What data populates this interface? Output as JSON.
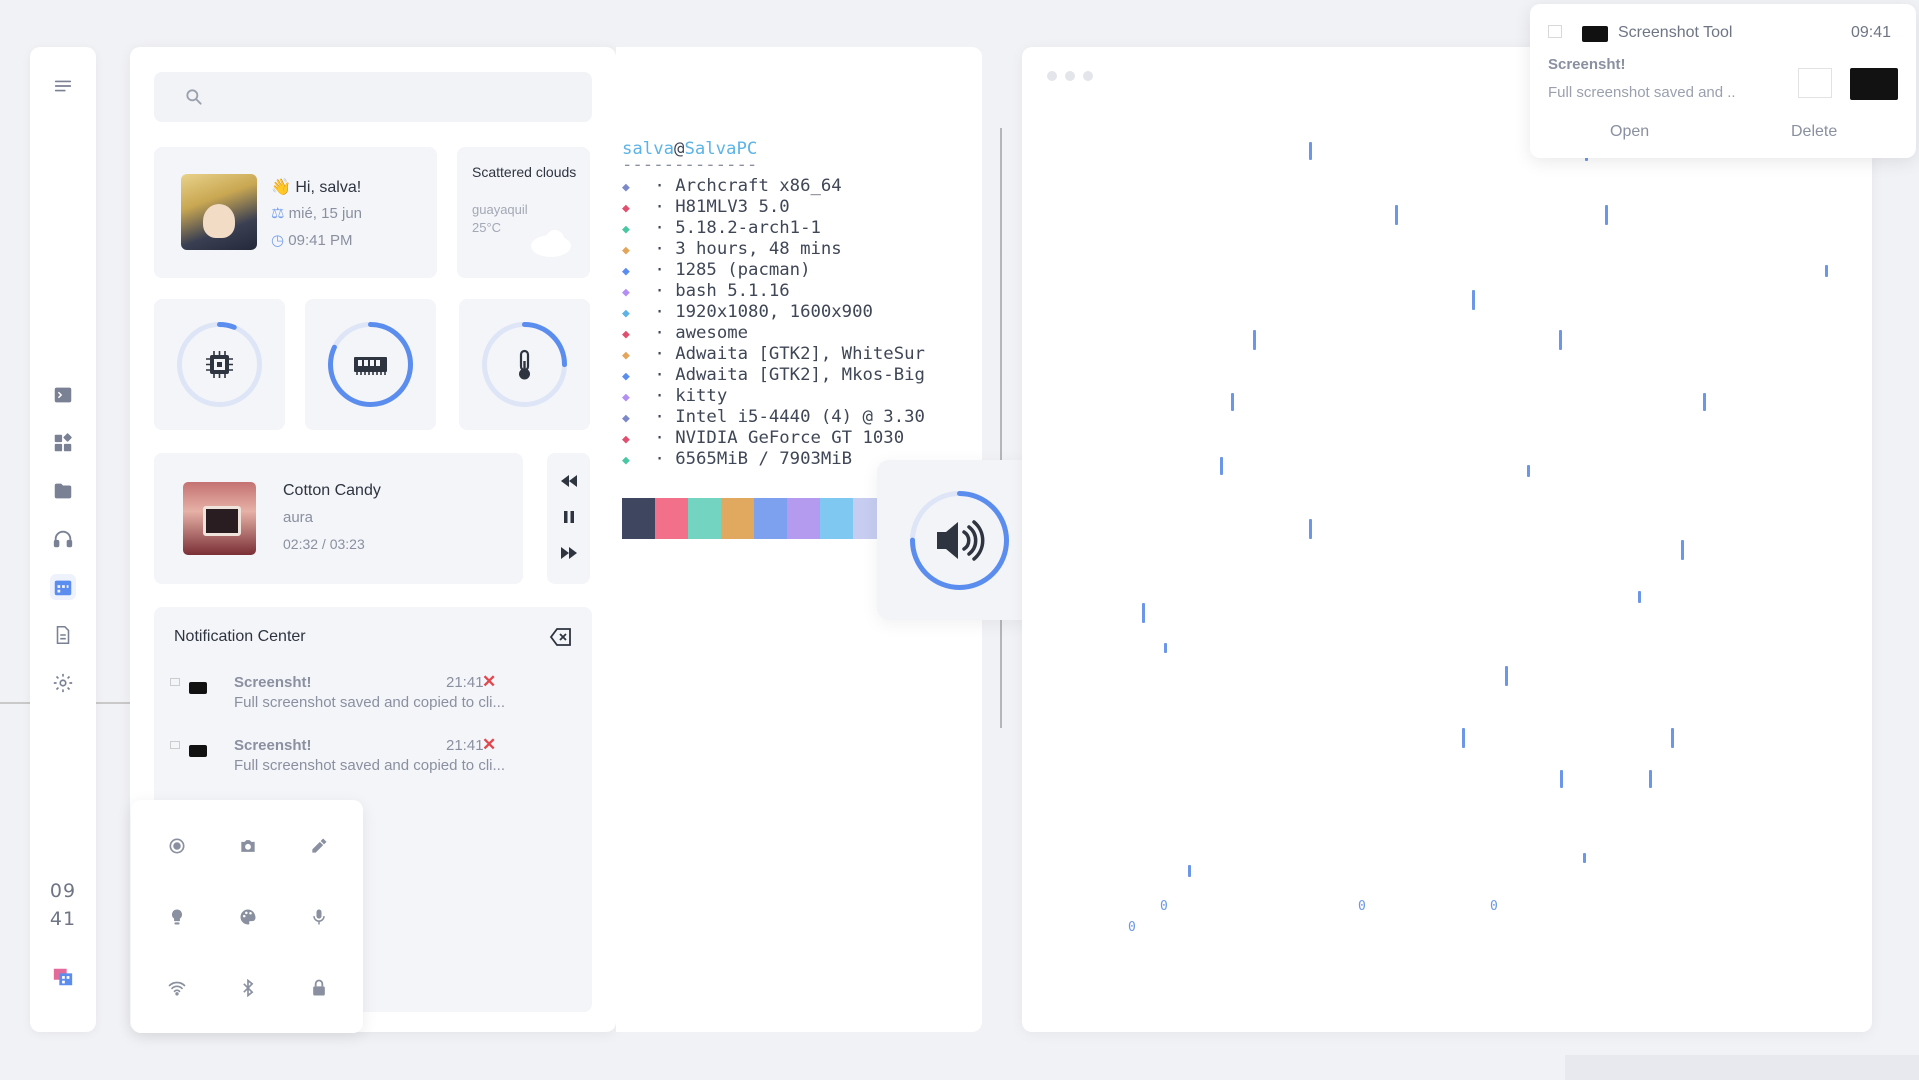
{
  "dock": {
    "clock_hour": "09",
    "clock_minute": "41",
    "icons": [
      "menu-icon",
      "terminal-icon",
      "widgets-icon",
      "folder-icon",
      "headphones-icon",
      "calendar-icon",
      "document-icon",
      "settings-icon",
      "app-launcher-icon"
    ],
    "active_icon": "calendar-icon"
  },
  "dashboard": {
    "search": {
      "placeholder": ""
    },
    "profile": {
      "greeting": "👋 Hi, salva!",
      "date": "mié, 15 jun",
      "time": "09:41 PM"
    },
    "weather": {
      "condition": "Scattered clouds",
      "location": "guayaquil",
      "temperature": "25°C"
    },
    "gauges": [
      {
        "name": "cpu",
        "icon": "cpu-icon",
        "level": 0.06
      },
      {
        "name": "ram",
        "icon": "ram-icon",
        "level": 0.82
      },
      {
        "name": "temperature",
        "icon": "thermometer-icon",
        "level": 0.25
      }
    ],
    "music": {
      "title": "Cotton Candy",
      "artist": "aura",
      "progress": "02:32 / 03:23"
    },
    "notification_center": {
      "title": "Notification Center",
      "items": [
        {
          "title": "Screensht!",
          "time": "21:41",
          "body": "Full screenshot saved and copied to cli..."
        },
        {
          "title": "Screensht!",
          "time": "21:41",
          "body": "Full screenshot saved and copied to cli..."
        }
      ]
    },
    "quick_settings": [
      "screen-record-icon",
      "camera-icon",
      "color-picker-icon",
      "lightbulb-icon",
      "palette-icon",
      "microphone-icon",
      "wifi-icon",
      "bluetooth-icon",
      "lock-icon"
    ]
  },
  "terminal": {
    "user": "salva",
    "at": "@",
    "host": "SalvaPC",
    "underline": "-------------",
    "lines": [
      {
        "value": "Archcraft x86_64",
        "color": "#7b88c9"
      },
      {
        "value": "H81MLV3 5.0",
        "color": "#e0506e"
      },
      {
        "value": "5.18.2-arch1-1",
        "color": "#48c7a3"
      },
      {
        "value": "3 hours, 48 mins",
        "color": "#e3a55a"
      },
      {
        "value": "1285 (pacman)",
        "color": "#5b8def"
      },
      {
        "value": "bash 5.1.16",
        "color": "#b38ef3"
      },
      {
        "value": "1920x1080, 1600x900",
        "color": "#5bb3e6"
      },
      {
        "value": "awesome",
        "color": "#e0506e"
      },
      {
        "value": "Adwaita [GTK2], WhiteSur",
        "color": "#e3a55a"
      },
      {
        "value": "Adwaita [GTK2], Mkos-Big",
        "color": "#5b8def"
      },
      {
        "value": "kitty",
        "color": "#b38ef3"
      },
      {
        "value": "Intel i5-4440 (4) @ 3.30",
        "color": "#7b88c9"
      },
      {
        "value": "NVIDIA GeForce GT 1030",
        "color": "#e0506e"
      },
      {
        "value": "6565MiB / 7903MiB",
        "color": "#48c7a3"
      }
    ],
    "palette": [
      "#3f4660",
      "#f2708a",
      "#72d4c1",
      "#e1a95f",
      "#7da1ef",
      "#b49bf0",
      "#7ec8f1",
      "#c6cdf0"
    ]
  },
  "volume_osd": {
    "level": 0.75
  },
  "toast": {
    "app": "Screenshot Tool",
    "time": "09:41",
    "title": "Screensht!",
    "body": "Full screenshot saved and ..",
    "open_label": "Open",
    "delete_label": "Delete"
  },
  "matrix": {
    "glyph": "0"
  }
}
